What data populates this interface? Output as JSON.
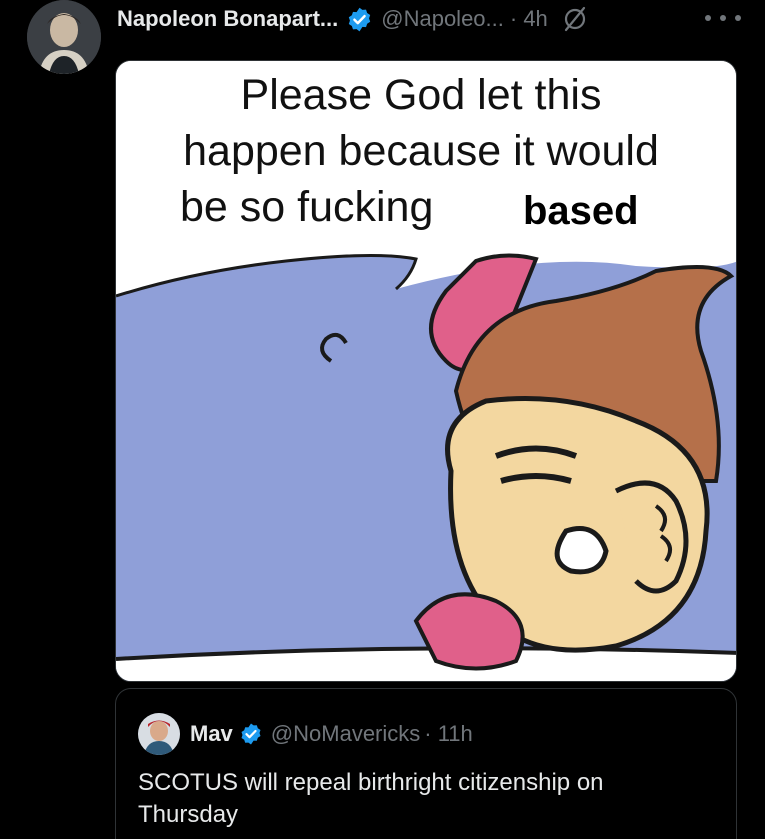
{
  "tweet": {
    "author_name": "Napoleon Bonapart...",
    "author_handle": "@Napoleo...",
    "time": "· 4h",
    "verified_color": "#1d9bf0"
  },
  "media": {
    "caption_lines": [
      "Please God let this",
      "happen because it would",
      "be so fucking"
    ],
    "caption_bold": "based",
    "colors": {
      "sky": "#8f9fd8",
      "hair": "#b5704a",
      "skin": "#f3d7a0",
      "hat": "#e0608a"
    }
  },
  "quoted_tweet": {
    "author_name": "Mav",
    "author_handle": "@NoMavericks",
    "time": "· 11h",
    "text": "SCOTUS will repeal birthright citizenship on Thursday"
  }
}
